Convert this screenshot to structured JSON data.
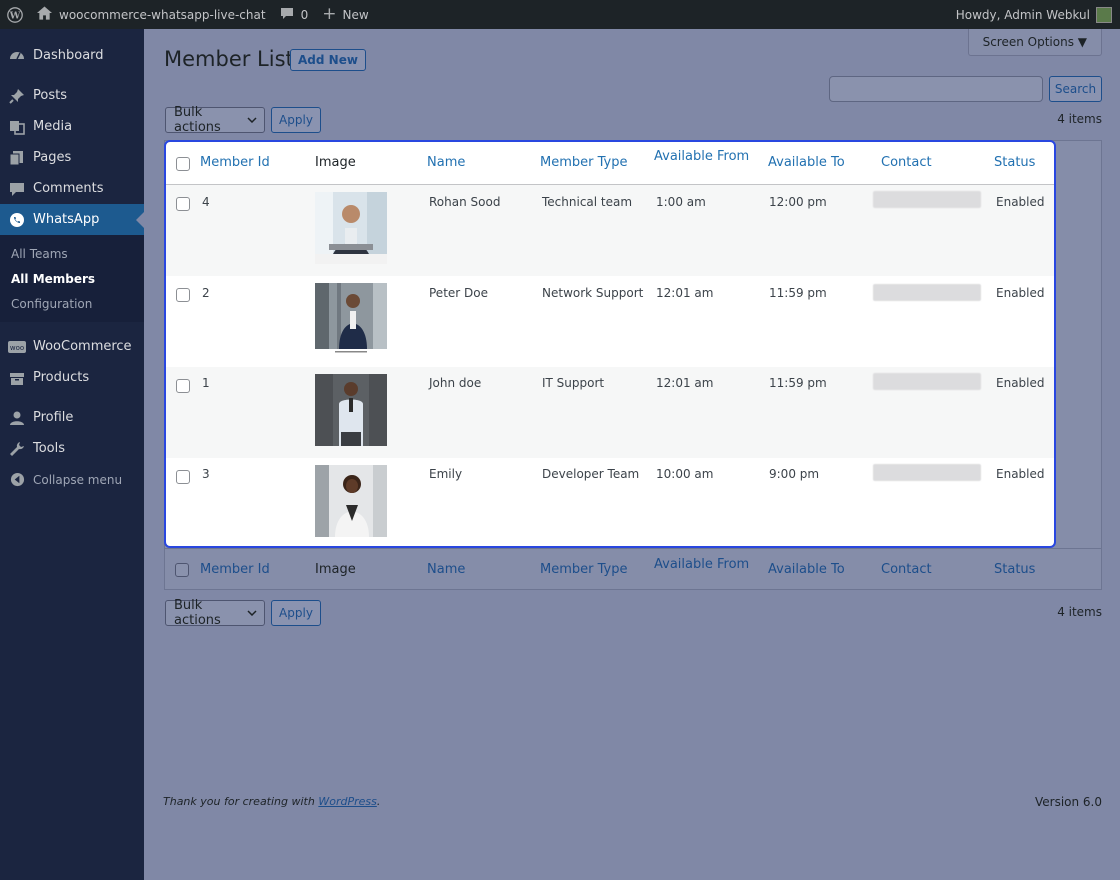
{
  "adminbar": {
    "site_name": "woocommerce-whatsapp-live-chat",
    "comments_count": "0",
    "new_label": "New",
    "howdy": "Howdy, Admin Webkul"
  },
  "sidebar": {
    "items": [
      {
        "label": "Dashboard",
        "icon": "dashboard-icon"
      },
      {
        "label": "Posts",
        "icon": "pin-icon"
      },
      {
        "label": "Media",
        "icon": "media-icon"
      },
      {
        "label": "Pages",
        "icon": "pages-icon"
      },
      {
        "label": "Comments",
        "icon": "comment-icon"
      },
      {
        "label": "WhatsApp",
        "icon": "whatsapp-icon"
      }
    ],
    "submenu": [
      "All Teams",
      "All Members",
      "Configuration"
    ],
    "items2": [
      {
        "label": "WooCommerce",
        "icon": "woo-icon"
      },
      {
        "label": "Products",
        "icon": "products-icon"
      },
      {
        "label": "Profile",
        "icon": "user-icon"
      },
      {
        "label": "Tools",
        "icon": "wrench-icon"
      }
    ],
    "collapse": "Collapse menu"
  },
  "page": {
    "screen_options": "Screen Options ▼",
    "title": "Member List",
    "add_new": "Add New",
    "search_button": "Search",
    "bulk_actions": "Bulk actions",
    "apply": "Apply",
    "items_count": "4 items"
  },
  "table": {
    "columns": [
      "Member Id",
      "Image",
      "Name",
      "Member Type",
      "Available From",
      "Available To",
      "Contact",
      "Status"
    ],
    "rows": [
      {
        "id": "4",
        "name": "Rohan Sood",
        "type": "Technical team",
        "from": "1:00 am",
        "to": "12:00 pm",
        "status": "Enabled"
      },
      {
        "id": "2",
        "name": "Peter Doe",
        "type": "Network Support",
        "from": "12:01 am",
        "to": "11:59 pm",
        "status": "Enabled"
      },
      {
        "id": "1",
        "name": "John doe",
        "type": "IT Support",
        "from": "12:01 am",
        "to": "11:59 pm",
        "status": "Enabled"
      },
      {
        "id": "3",
        "name": "Emily",
        "type": "Developer Team",
        "from": "10:00 am",
        "to": "9:00 pm",
        "status": "Enabled"
      }
    ]
  },
  "footer": {
    "thanks_prefix": "Thank you for creating with ",
    "wordpress": "WordPress",
    "thanks_suffix": ".",
    "version": "Version 6.0"
  },
  "colors": {
    "accent": "#2271b1",
    "highlight_border": "#2947e0",
    "sidebar_bg": "#1b2540",
    "current_menu": "#1d5a8f"
  }
}
